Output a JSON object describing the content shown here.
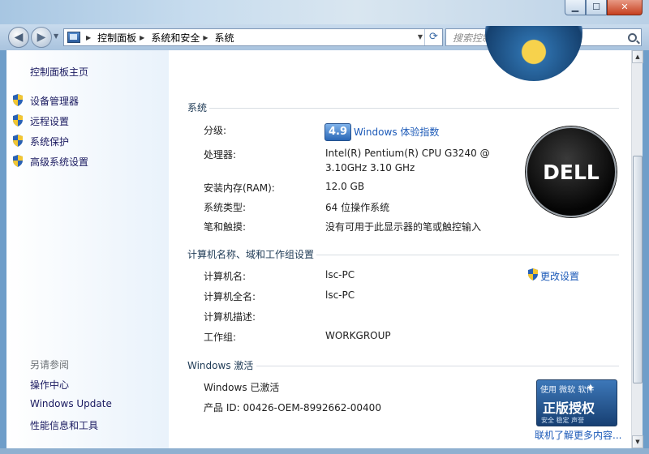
{
  "window": {
    "minimize_glyph": "▁",
    "maximize_glyph": "☐",
    "close_glyph": "✕"
  },
  "nav": {
    "back_glyph": "◀",
    "forward_glyph": "▶",
    "breadcrumbs": [
      "控制面板",
      "系统和安全",
      "系统"
    ],
    "search_placeholder": "搜索控制面板"
  },
  "sidebar": {
    "home": "控制面板主页",
    "items": [
      {
        "label": "设备管理器",
        "icon": "shield-icon"
      },
      {
        "label": "远程设置",
        "icon": "shield-icon"
      },
      {
        "label": "系统保护",
        "icon": "shield-icon"
      },
      {
        "label": "高级系统设置",
        "icon": "shield-icon"
      }
    ],
    "see_also_title": "另请参阅",
    "see_also": [
      "操作中心",
      "Windows Update",
      "性能信息和工具"
    ]
  },
  "system": {
    "title": "系统",
    "rating_label": "分级:",
    "rating_score": "4.9",
    "rating_link": "Windows 体验指数",
    "processor_label": "处理器:",
    "processor_line1": "Intel(R) Pentium(R) CPU G3240 @",
    "processor_line2": "3.10GHz   3.10 GHz",
    "ram_label": "安装内存(RAM):",
    "ram_value": "12.0 GB",
    "type_label": "系统类型:",
    "type_value": "64 位操作系统",
    "pen_label": "笔和触摸:",
    "pen_value": "没有可用于此显示器的笔或触控输入",
    "oem_logo_text": "DELL"
  },
  "computer": {
    "title": "计算机名称、域和工作组设置",
    "name_label": "计算机名:",
    "name_value": "lsc-PC",
    "fullname_label": "计算机全名:",
    "fullname_value": "lsc-PC",
    "desc_label": "计算机描述:",
    "desc_value": "",
    "workgroup_label": "工作组:",
    "workgroup_value": "WORKGROUP",
    "change_settings": "更改设置"
  },
  "activation": {
    "title": "Windows 激活",
    "status": "Windows 已激活",
    "product_id": "产品 ID: 00426-OEM-8992662-00400",
    "badge_top": "使用 微软 软件",
    "badge_main": "正版授权",
    "badge_sub": "安全 稳定 声誉",
    "learn_more": "联机了解更多内容..."
  }
}
